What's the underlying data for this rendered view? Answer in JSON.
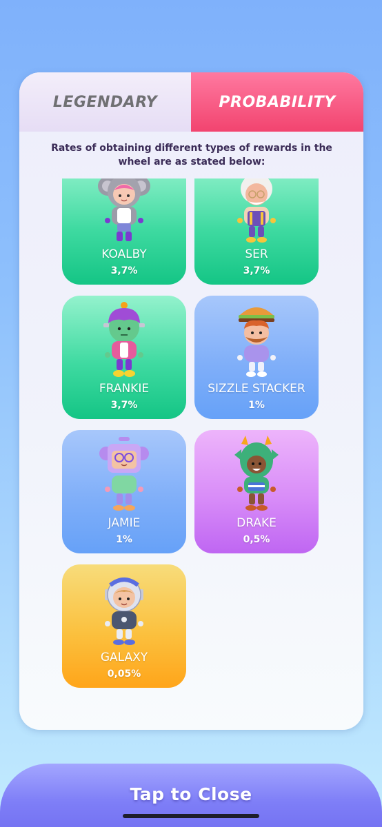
{
  "tabs": {
    "legendary": "LEGENDARY",
    "probability": "PROBABILITY",
    "active": "probability"
  },
  "description": "Rates of obtaining different types of rewards in the wheel are as stated below:",
  "rewards": [
    {
      "name": "KOALBY",
      "rate": "3,7%",
      "color": "green",
      "icon": "koala-hood-figure-icon"
    },
    {
      "name": "SER",
      "rate": "3,7%",
      "color": "green",
      "icon": "old-man-figure-icon"
    },
    {
      "name": "FRANKIE",
      "rate": "3,7%",
      "color": "green",
      "icon": "frankenstein-figure-icon"
    },
    {
      "name": "SIZZLE STACKER",
      "rate": "1%",
      "color": "blue",
      "icon": "burger-hat-figure-icon"
    },
    {
      "name": "JAMIE",
      "rate": "1%",
      "color": "blue",
      "icon": "robot-box-figure-icon"
    },
    {
      "name": "DRAKE",
      "rate": "0,5%",
      "color": "purple",
      "icon": "dragon-costume-figure-icon"
    },
    {
      "name": "GALAXY",
      "rate": "0,05%",
      "color": "yellow",
      "icon": "astronaut-figure-icon"
    }
  ],
  "colors": {
    "green": "#3fdaa1",
    "blue": "#80aff9",
    "purple": "#d88cf8",
    "yellow": "#fbc13f",
    "active_tab": "#f2446f",
    "close_bar": "#7e7ef7"
  },
  "close_button": "Tap to Close"
}
